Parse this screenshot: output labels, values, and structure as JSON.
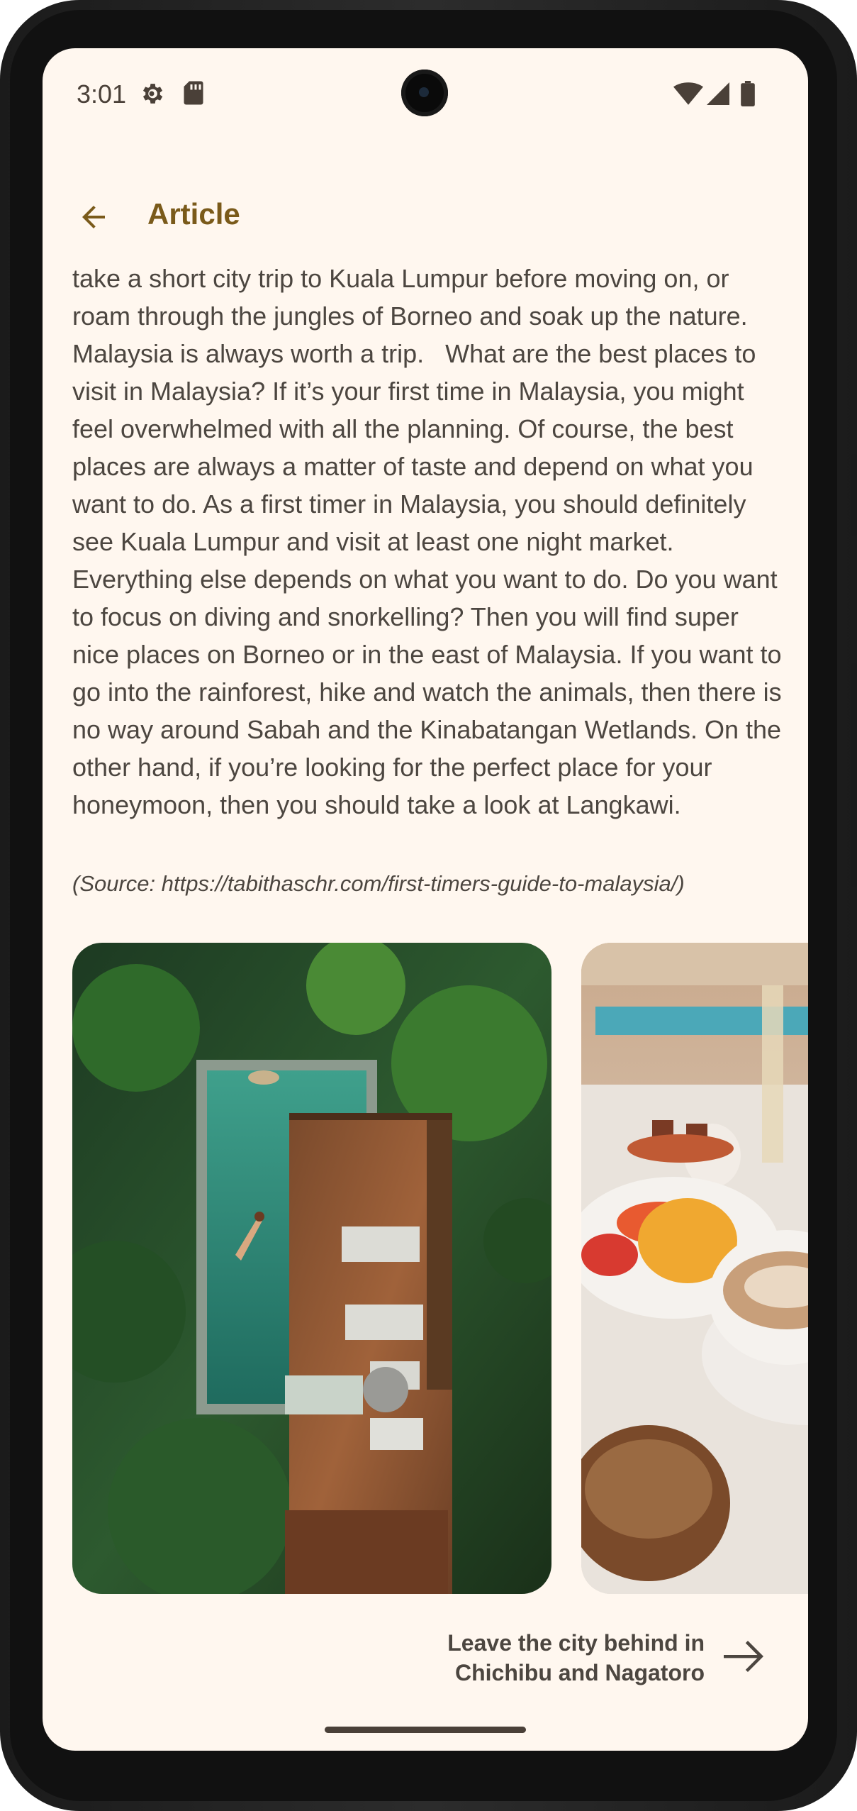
{
  "status_bar": {
    "time": "3:01",
    "left_icons": [
      "settings-icon",
      "sd-card-icon"
    ],
    "right_icons": [
      "wifi-icon",
      "cellular-signal-icon",
      "battery-icon"
    ]
  },
  "app_bar": {
    "back_icon": "arrow-back-icon",
    "title": "Article"
  },
  "article": {
    "body": "take a short city trip to Kuala Lumpur before moving on, or roam through the jungles of Borneo and soak up the nature. Malaysia is always worth a trip.   What are the best places to visit in Malaysia? If it’s your first time in Malaysia, you might feel overwhelmed with all the planning. Of course, the best places are always a matter of taste and depend on what you want to do. As a first timer in Malaysia, you should definitely see Kuala Lumpur and visit at least one night market.   Everything else depends on what you want to do. Do you want to focus on diving and snorkelling? Then you will find super nice places on Borneo or in the east of Malaysia. If you want to go into the rainforest, hike and watch the animals, then there is no way around Sabah and the Kinabatangan Wetlands. On the other hand, if you’re looking for the perfect place for your honeymoon, then you should take a look at Langkawi.",
    "source": "(Source: https://tabithaschr.com/first-timers-guide-to-malaysia/)"
  },
  "carousel": {
    "images": [
      "aerial-pool-image",
      "breakfast-table-image"
    ]
  },
  "next_article": {
    "label_line1": "Leave the city behind in",
    "label_line2": "Chichibu and Nagatoro",
    "icon": "arrow-forward-icon"
  },
  "colors": {
    "background": "#fff7ef",
    "accent": "#7a5a1a",
    "body_text": "#4c4640"
  }
}
